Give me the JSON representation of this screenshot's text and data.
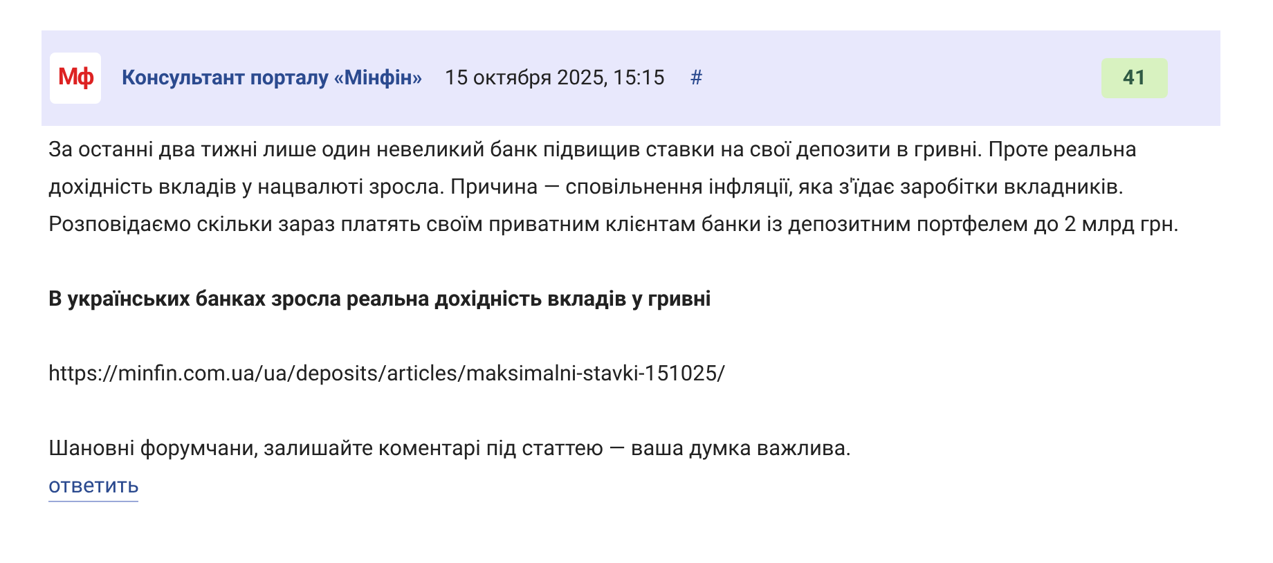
{
  "post": {
    "logo": "Мф",
    "author": "Консультант порталу «Мінфін»",
    "date": "15 октября 2025, 15:15",
    "anchor": "#",
    "rating": "41",
    "paragraphs": [
      {
        "kind": "text",
        "text": "За останні два тижні лише один невеликий банк підвищив ставки на свої депозити в гривні. Проте реальна дохідність вкладів у нацвалюті зросла. Причина — сповільнення інфляції, яка з'їдає заробітки вкладників. Розповідаємо скільки зараз платять своїм приватним клієнтам банки із депозитним портфелем до 2 млрд грн."
      },
      {
        "kind": "heading",
        "text": "В українських банках зросла реальна дохідність вкладів у гривні"
      },
      {
        "kind": "text",
        "text": "https://minfin.com.ua/ua/deposits/articles/maksimalni-stavki-151025/"
      },
      {
        "kind": "text",
        "text": "Шановні форумчани, залишайте коментарі під статтею — ваша думка важлива."
      }
    ],
    "reply": "ответить"
  }
}
